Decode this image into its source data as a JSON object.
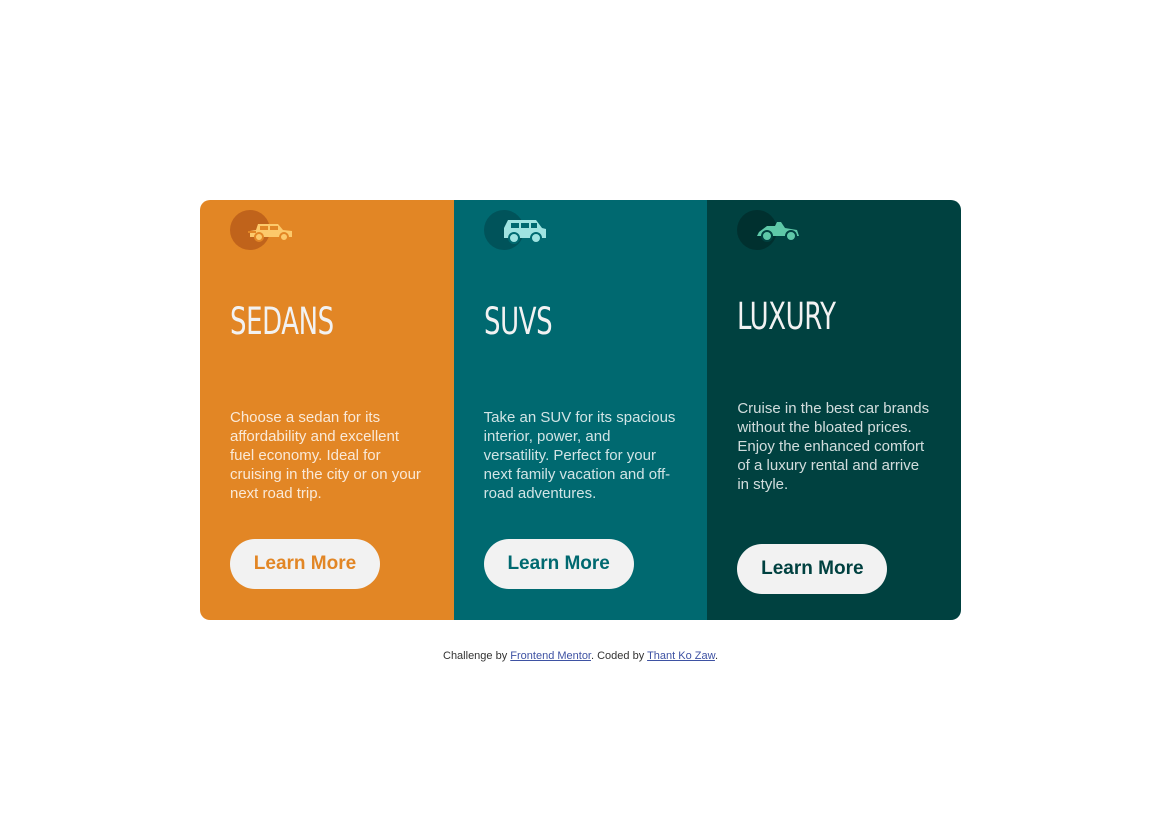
{
  "cards": [
    {
      "id": "sedans",
      "title": "Sedans",
      "description": "Choose a sedan for its affordability and excellent fuel economy. Ideal for cruising in the city or on your next road trip.",
      "button_label": "Learn More",
      "icon": "sedan-car-icon",
      "color": "#e28625"
    },
    {
      "id": "suvs",
      "title": "SUVs",
      "description": "Take an SUV for its spacious interior, power, and versatility. Perfect for your next family vacation and off-road adventures.",
      "button_label": "Learn More",
      "icon": "suv-car-icon",
      "color": "#006970"
    },
    {
      "id": "luxury",
      "title": "Luxury",
      "description": "Cruise in the best car brands without the bloated prices. Enjoy the enhanced comfort of a luxury rental and arrive in style.",
      "button_label": "Learn More",
      "icon": "luxury-car-icon",
      "color": "#004140"
    }
  ],
  "attribution": {
    "prefix": "Challenge by ",
    "link1": "Frontend Mentor",
    "middle": ". Coded by ",
    "link2": "Thant Ko Zaw",
    "suffix": "."
  }
}
